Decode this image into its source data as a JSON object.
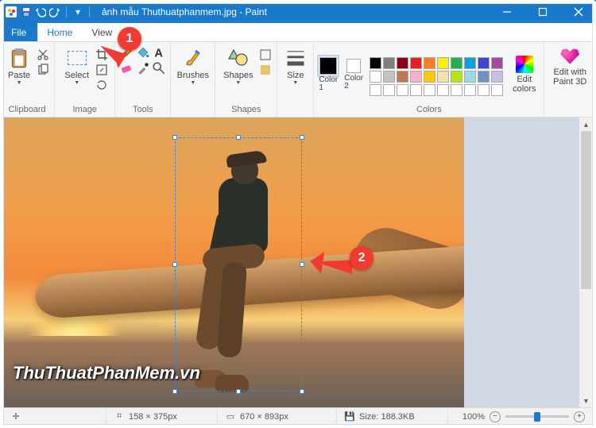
{
  "title": "ảnh mẫu Thuthuatphanmem.jpg - Paint",
  "tabs": {
    "file": "File",
    "home": "Home",
    "view": "View"
  },
  "ribbon": {
    "clipboard": {
      "label": "Clipboard",
      "paste": "Paste"
    },
    "image": {
      "label": "Image",
      "select": "Select"
    },
    "tools": {
      "label": "Tools"
    },
    "brushes": {
      "label": "Brushes"
    },
    "shapes": {
      "label": "Shapes"
    },
    "size": {
      "label": "Size"
    },
    "colors": {
      "label": "Colors",
      "color1": "Color\n1",
      "color2": "Color\n2",
      "edit_colors": "Edit\ncolors",
      "palette": [
        "#000000",
        "#7f7f7f",
        "#880015",
        "#ed1c24",
        "#ff7f27",
        "#fff200",
        "#22b14c",
        "#00a2e8",
        "#3f48cc",
        "#a349a4",
        "#ffffff",
        "#c3c3c3",
        "#b97a57",
        "#ffaec9",
        "#ffc90e",
        "#efe4b0",
        "#b5e61d",
        "#99d9ea",
        "#7092be",
        "#c8bfe7",
        "#ffffff",
        "#ffffff",
        "#ffffff",
        "#ffffff",
        "#ffffff",
        "#ffffff",
        "#ffffff",
        "#ffffff",
        "#ffffff",
        "#ffffff"
      ]
    },
    "paint3d": "Edit with\nPaint 3D"
  },
  "callouts": {
    "one": "1",
    "two": "2"
  },
  "watermark": "ThuThuatPhanMem.vn",
  "status": {
    "selection_dims": "158 × 375px",
    "canvas_dims": "670 × 893px",
    "file_size": "Size: 188.3KB",
    "zoom": "100%"
  }
}
